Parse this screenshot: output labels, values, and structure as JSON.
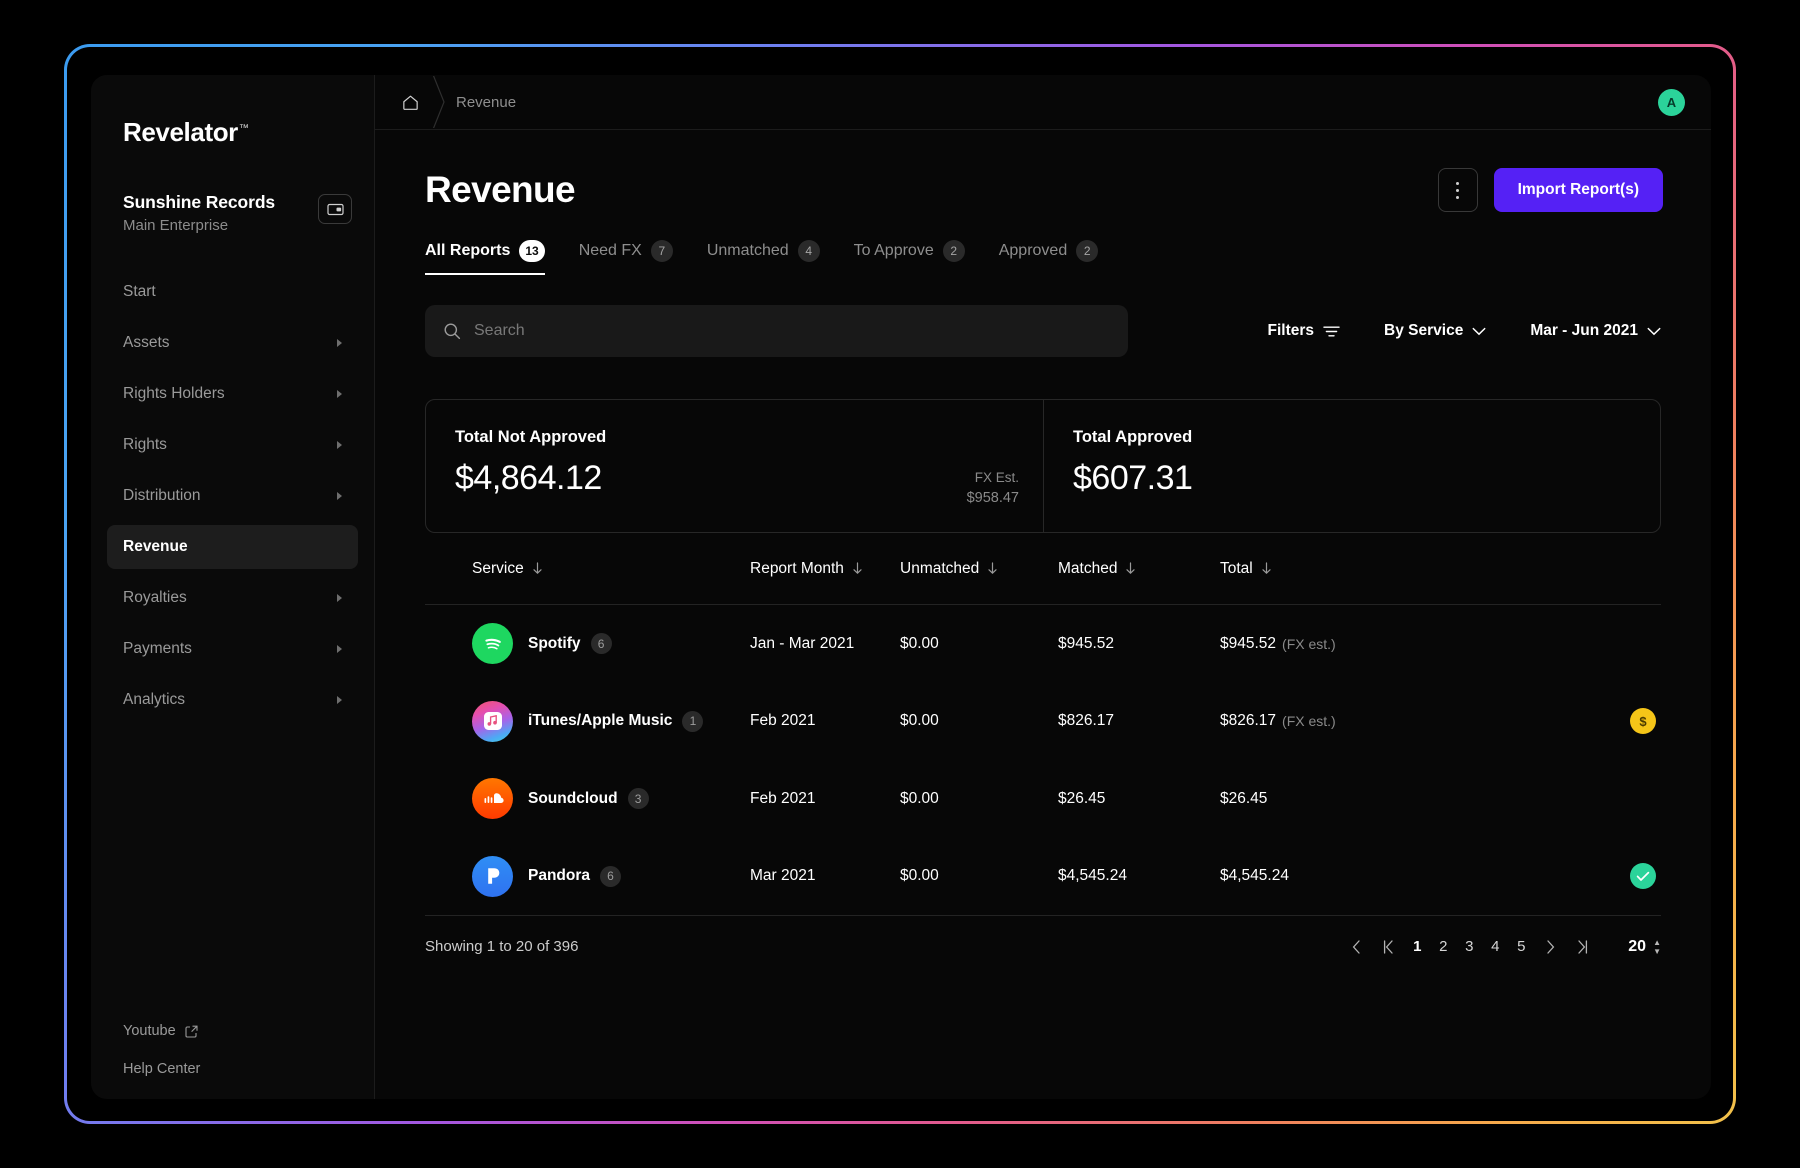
{
  "sidebar": {
    "brand": "Revelator",
    "brand_tm": "™",
    "org_name": "Sunshine Records",
    "org_sub": "Main Enterprise",
    "org_switch_icon": "switch-account-icon",
    "items": [
      {
        "label": "Start",
        "expandable": false,
        "active": false
      },
      {
        "label": "Assets",
        "expandable": true,
        "active": false
      },
      {
        "label": "Rights Holders",
        "expandable": true,
        "active": false
      },
      {
        "label": "Rights",
        "expandable": true,
        "active": false
      },
      {
        "label": "Distribution",
        "expandable": true,
        "active": false
      },
      {
        "label": "Revenue",
        "expandable": false,
        "active": true
      },
      {
        "label": "Royalties",
        "expandable": true,
        "active": false
      },
      {
        "label": "Payments",
        "expandable": true,
        "active": false
      },
      {
        "label": "Analytics",
        "expandable": true,
        "active": false
      }
    ],
    "footer_links": [
      {
        "label": "Youtube",
        "icon": "external-link-icon"
      },
      {
        "label": "Help Center",
        "icon": ""
      }
    ]
  },
  "breadcrumb": {
    "home_icon": "home-icon",
    "current": "Revenue"
  },
  "account": {
    "avatar_initial": "A",
    "avatar_color": "#2bd39a"
  },
  "header": {
    "title": "Revenue",
    "kebab_icon": "more-vertical-icon",
    "import_button": "Import Report(s)",
    "import_button_color": "#5521f5"
  },
  "tabs": [
    {
      "label": "All Reports",
      "badge": "13",
      "active": true
    },
    {
      "label": "Need FX",
      "badge": "7",
      "active": false
    },
    {
      "label": "Unmatched",
      "badge": "4",
      "active": false
    },
    {
      "label": "To Approve",
      "badge": "2",
      "active": false
    },
    {
      "label": "Approved",
      "badge": "2",
      "active": false
    }
  ],
  "search": {
    "placeholder": "Search",
    "value": "",
    "icon": "search-icon"
  },
  "controls": {
    "filters_label": "Filters",
    "filters_icon": "filter-icon",
    "group_by_label": "By Service",
    "group_by_icon": "chevron-down-icon",
    "date_range_label": "Mar - Jun 2021",
    "date_range_icon": "chevron-down-icon"
  },
  "summary": {
    "not_approved": {
      "title": "Total Not Approved",
      "value": "$4,864.12",
      "fx_label": "FX Est.",
      "fx_value": "$958.47"
    },
    "approved": {
      "title": "Total Approved",
      "value": "$607.31"
    }
  },
  "table": {
    "columns": [
      {
        "label": "Service",
        "sort_icon": "sort-down-icon"
      },
      {
        "label": "Report Month",
        "sort_icon": "sort-down-icon"
      },
      {
        "label": "Unmatched",
        "sort_icon": "sort-down-icon"
      },
      {
        "label": "Matched",
        "sort_icon": "sort-down-icon"
      },
      {
        "label": "Total",
        "sort_icon": "sort-down-icon"
      }
    ],
    "rows": [
      {
        "service": "Spotify",
        "service_icon": "spotify-icon",
        "count": "6",
        "month": "Jan - Mar  2021",
        "unmatched": "$0.00",
        "matched": "$945.52",
        "total": "$945.52",
        "total_note": "(FX est.)",
        "status": ""
      },
      {
        "service": "iTunes/Apple Music",
        "service_icon": "apple-music-icon",
        "count": "1",
        "month": "Feb 2021",
        "unmatched": "$0.00",
        "matched": "$826.17",
        "total": "$826.17",
        "total_note": "(FX est.)",
        "status": "fx"
      },
      {
        "service": "Soundcloud",
        "service_icon": "soundcloud-icon",
        "count": "3",
        "month": "Feb 2021",
        "unmatched": "$0.00",
        "matched": "$26.45",
        "total": "$26.45",
        "total_note": "",
        "status": ""
      },
      {
        "service": "Pandora",
        "service_icon": "pandora-icon",
        "count": "6",
        "month": "Mar 2021",
        "unmatched": "$0.00",
        "matched": "$4,545.24",
        "total": "$4,545.24",
        "total_note": "",
        "status": "approved"
      }
    ]
  },
  "footer": {
    "showing": "Showing 1 to 20 of 396",
    "pages": [
      "1",
      "2",
      "3",
      "4",
      "5"
    ],
    "current_page": "1",
    "page_size": "20",
    "prev_icon": "chevron-left-icon",
    "first_icon": "first-page-icon",
    "next_icon": "chevron-right-icon",
    "last_icon": "last-page-icon"
  }
}
